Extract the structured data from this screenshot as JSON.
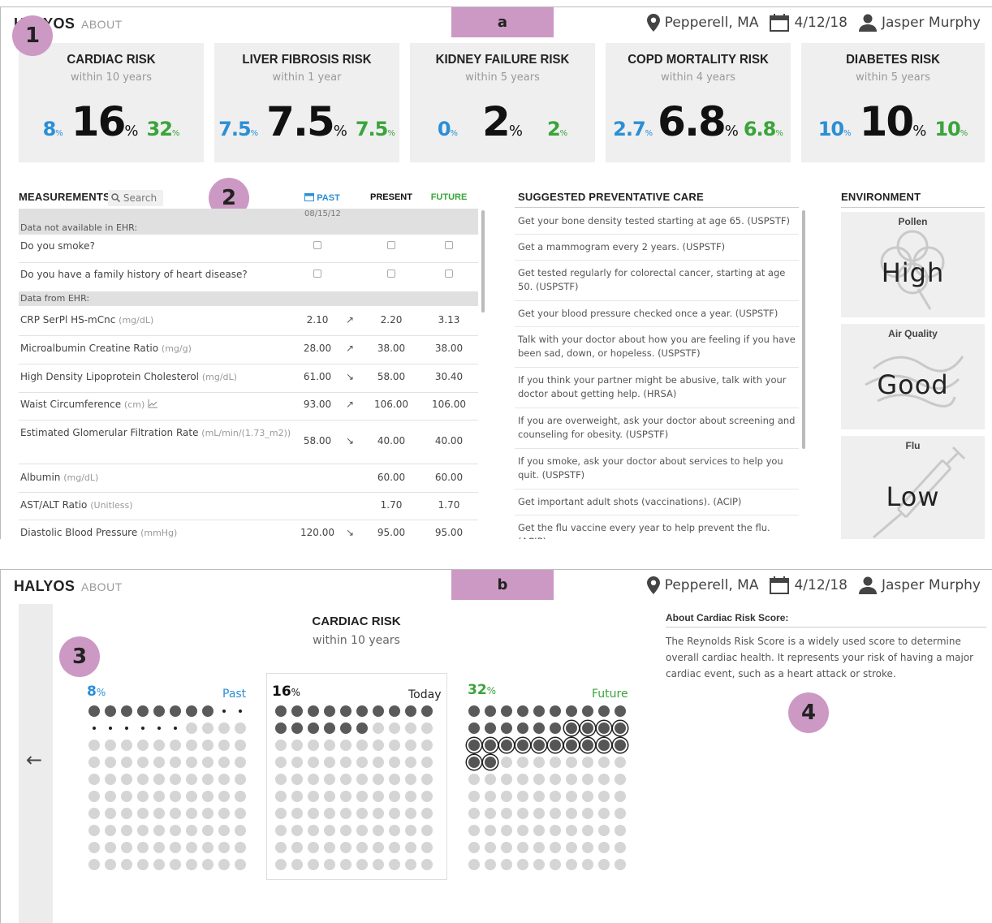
{
  "app": {
    "brand": "HALYOS",
    "about": "ABOUT",
    "location": "Pepperell, MA",
    "date": "4/12/18",
    "user": "Jasper Murphy"
  },
  "panel_a": {
    "tag": "a",
    "callout_1": "1",
    "callout_2": "2",
    "risks": [
      {
        "title": "CARDIAC RISK",
        "sub": "within 10 years",
        "past": "8",
        "present": "16",
        "future": "32"
      },
      {
        "title": "LIVER FIBROSIS RISK",
        "sub": "within 1 year",
        "past": "7.5",
        "present": "7.5",
        "future": "7.5"
      },
      {
        "title": "KIDNEY FAILURE RISK",
        "sub": "within 5 years",
        "past": "0",
        "present": "2",
        "future": "2"
      },
      {
        "title": "COPD MORTALITY RISK",
        "sub": "within 4 years",
        "past": "2.7",
        "present": "6.8",
        "future": "6.8"
      },
      {
        "title": "DIABETES RISK",
        "sub": "within 5 years",
        "past": "10",
        "present": "10",
        "future": "10"
      }
    ],
    "percent": "%",
    "measurements": {
      "title": "MEASUREMENTS",
      "search_placeholder": "Search",
      "col_past": "PAST",
      "col_present": "PRESENT",
      "col_future": "FUTURE",
      "past_date": "08/15/12",
      "section_no_ehr": "Data not available in EHR:",
      "q_smoke": "Do you smoke?",
      "q_family": "Do you have a family history of heart disease?",
      "section_ehr": "Data from EHR:",
      "rows": [
        {
          "label": "CRP SerPl HS-mCnc",
          "unit": "(mg/dL)",
          "past": "2.10",
          "trend": "↗",
          "present": "2.20",
          "future": "3.13"
        },
        {
          "label": "Microalbumin Creatine Ratio",
          "unit": "(mg/g)",
          "past": "28.00",
          "trend": "↗",
          "present": "38.00",
          "future": "38.00"
        },
        {
          "label": "High Density Lipoprotein Cholesterol",
          "unit": "(mg/dL)",
          "past": "61.00",
          "trend": "↘",
          "present": "58.00",
          "future": "30.40"
        },
        {
          "label": "Waist Circumference",
          "unit": "(cm)",
          "past": "93.00",
          "trend": "↗",
          "present": "106.00",
          "future": "106.00"
        },
        {
          "label": "Estimated Glomerular Filtration Rate",
          "unit": "(mL/min/(1.73_m2))",
          "past": "58.00",
          "trend": "↘",
          "present": "40.00",
          "future": "40.00"
        },
        {
          "label": "Albumin",
          "unit": "(mg/dL)",
          "past": "",
          "trend": "",
          "present": "60.00",
          "future": "60.00"
        },
        {
          "label": "AST/ALT Ratio",
          "unit": "(Unitless)",
          "past": "",
          "trend": "",
          "present": "1.70",
          "future": "1.70"
        },
        {
          "label": "Diastolic Blood Pressure",
          "unit": "(mmHg)",
          "past": "120.00",
          "trend": "↘",
          "present": "95.00",
          "future": "95.00"
        }
      ]
    },
    "care": {
      "title": "SUGGESTED PREVENTATIVE CARE",
      "items": [
        "Get your bone density tested starting at age 65. (USPSTF)",
        "Get a mammogram every 2 years. (USPSTF)",
        "Get tested regularly for colorectal cancer, starting at age 50. (USPSTF)",
        "Get your blood pressure checked once a year. (USPSTF)",
        "Talk with your doctor about how you are feeling if you have been sad, down, or hopeless. (USPSTF)",
        "If you think your partner might be abusive, talk with your doctor about getting help. (HRSA)",
        "If you are overweight, ask your doctor about screening and counseling for obesity. (USPSTF)",
        "If you smoke, ask your doctor about services to help you quit. (USPSTF)",
        "Get important adult shots (vaccinations). (ACIP)",
        "Get the flu vaccine every year to help prevent the flu. (ACIP)"
      ]
    },
    "environment": {
      "title": "ENVIRONMENT",
      "cards": [
        {
          "label": "Pollen",
          "value": "High"
        },
        {
          "label": "Air Quality",
          "value": "Good"
        },
        {
          "label": "Flu",
          "value": "Low"
        }
      ]
    }
  },
  "panel_b": {
    "tag": "b",
    "callout_3": "3",
    "callout_4": "4",
    "title": "CARDIAC RISK",
    "sub": "within 10 years",
    "past": {
      "pct": "8",
      "label": "Past"
    },
    "today": {
      "pct": "16",
      "label": "Today"
    },
    "future": {
      "pct": "32",
      "label": "Future"
    },
    "about_title": "About Cardiac Risk Score:",
    "about_text": "The Reynolds Risk Score is a widely used score to determine overall cardiac health. It represents your risk of having a major cardiac event, such as a heart attack or stroke."
  },
  "colors": {
    "accent_callout": "#cc99c4",
    "past": "#2a8fd6",
    "future": "#3aa43a",
    "card_bg": "#efefef"
  },
  "icons": [
    "map-pin-icon",
    "calendar-icon",
    "user-icon",
    "search-icon",
    "chart-icon",
    "arrow-left-icon",
    "pollen-icon",
    "air-quality-icon",
    "syringe-icon"
  ]
}
